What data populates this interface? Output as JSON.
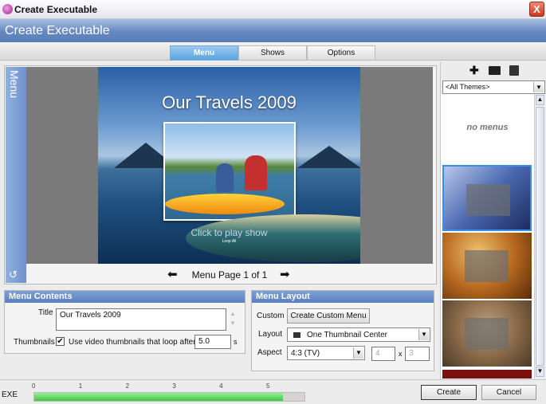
{
  "window": {
    "title": "Create Executable",
    "close": "X"
  },
  "header": {
    "title": "Create Executable"
  },
  "tabs": [
    {
      "label": "Menu",
      "active": true
    },
    {
      "label": "Shows"
    },
    {
      "label": "Options"
    }
  ],
  "side_tab": {
    "label": "Menu"
  },
  "preview": {
    "title": "Our Travels 2009",
    "play_text": "Click to play show",
    "loop_text": "Loop All",
    "page_label": "Menu Page 1 of 1"
  },
  "menu_contents": {
    "header": "Menu Contents",
    "title_label": "Title",
    "title_value": "Our Travels 2009",
    "thumbnails_label": "Thumbnails",
    "checkbox_label": "Use video thumbnails that loop after",
    "checked": true,
    "loop_value": "5.0",
    "unit": "s"
  },
  "menu_layout": {
    "header": "Menu Layout",
    "custom_label": "Custom",
    "custom_button": "Create Custom Menu",
    "layout_label": "Layout",
    "layout_value": "One Thumbnail Center",
    "aspect_label": "Aspect",
    "aspect_value": "4:3 (TV)",
    "aspect_w": "4",
    "aspect_x": "x",
    "aspect_h": "3"
  },
  "themes": {
    "filter": "<All Themes>",
    "empty_text": "no menus",
    "icons": [
      "plus-icon",
      "folder-open-icon",
      "save-icon"
    ]
  },
  "footer": {
    "exe_label": "EXE",
    "ticks": [
      "0",
      "1",
      "2",
      "3",
      "4",
      "5"
    ],
    "progress_value": 5.3,
    "progress_max": 5.8,
    "create": "Create",
    "cancel": "Cancel"
  },
  "colors": {
    "accent": "#5a7fc0",
    "progress": "#40c840",
    "active_tab": "#5aa3e0"
  }
}
